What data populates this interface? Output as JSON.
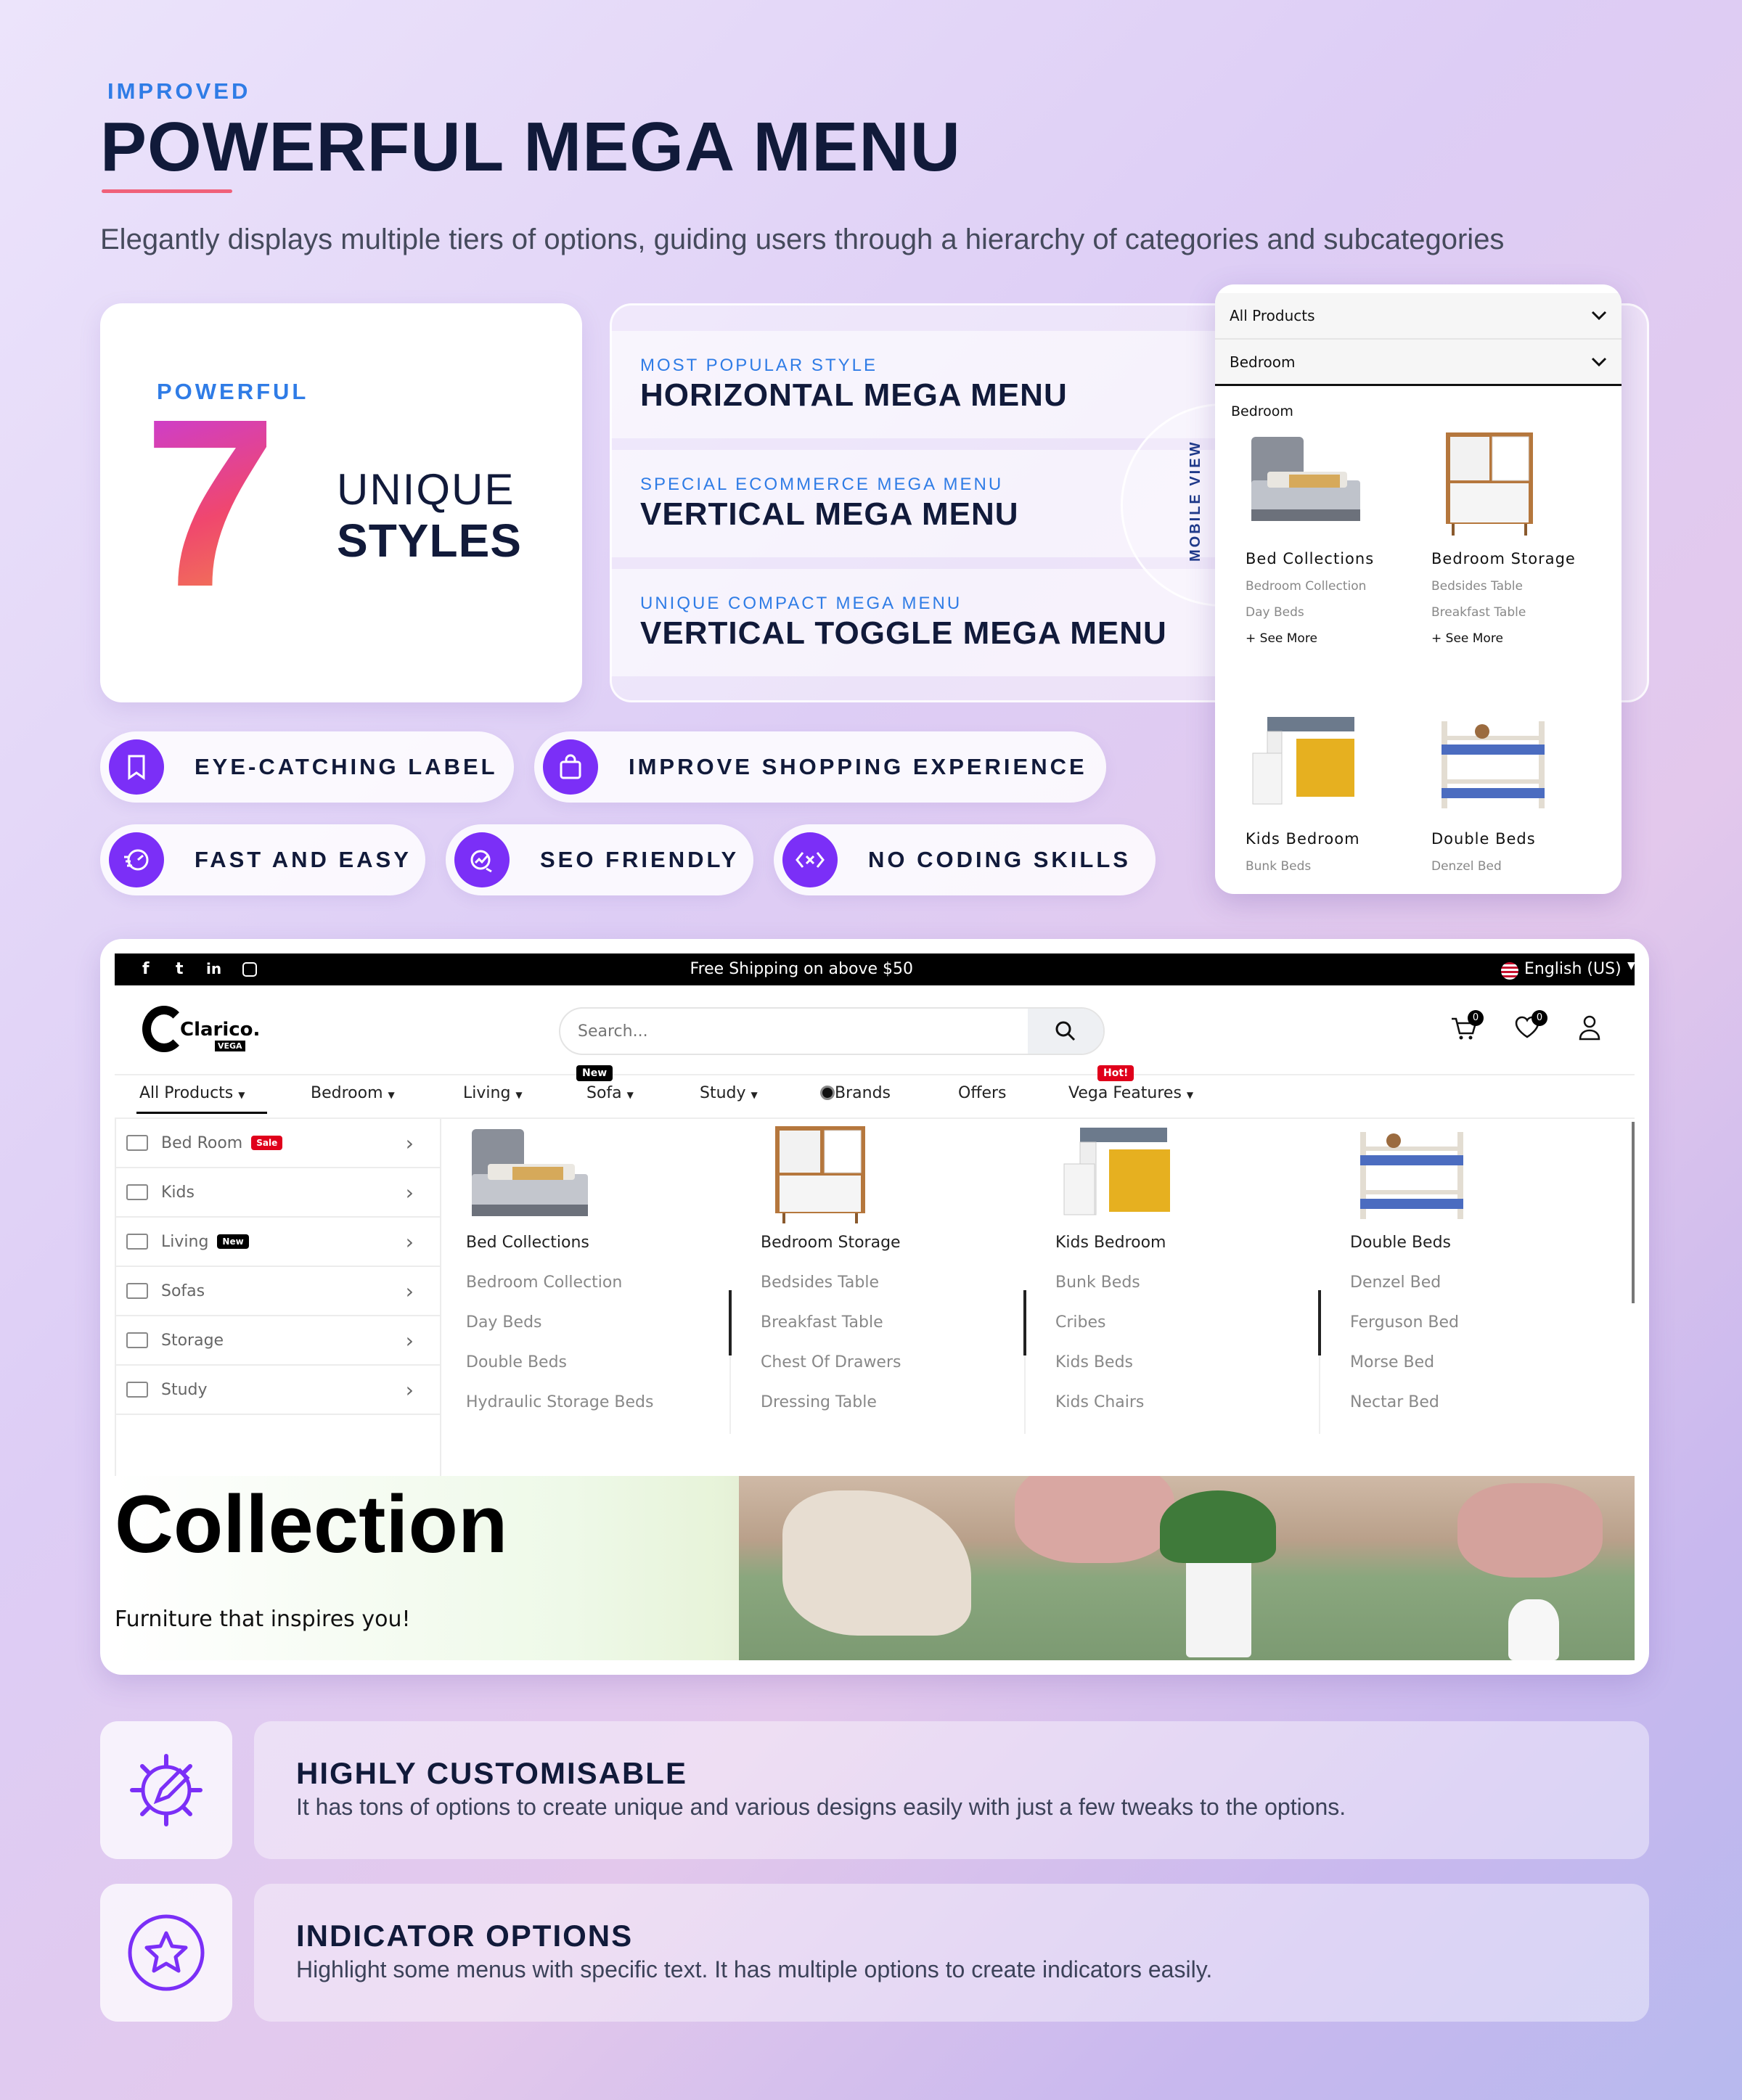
{
  "header": {
    "kicker": "IMPROVED",
    "title": "POWERFUL MEGA MENU",
    "subtitle": "Elegantly displays multiple tiers of options, guiding users through a hierarchy of categories and subcategories"
  },
  "styles_card": {
    "kicker": "POWERFUL",
    "number": "7",
    "line1": "UNIQUE",
    "line2": "STYLES"
  },
  "menu_styles": [
    {
      "kicker": "MOST POPULAR STYLE",
      "title": "HORIZONTAL MEGA MENU"
    },
    {
      "kicker": "SPECIAL ECOMMERCE MEGA MENU",
      "title": "VERTICAL MEGA MENU"
    },
    {
      "kicker": "UNIQUE COMPACT MEGA MENU",
      "title": "VERTICAL TOGGLE MEGA MENU"
    }
  ],
  "mobile_view_label": "MOBILE VIEW",
  "features": [
    "EYE-CATCHING LABEL",
    "IMPROVE SHOPPING EXPERIENCE",
    "FAST AND EASY",
    "SEO FRIENDLY",
    "NO CODING SKILLS"
  ],
  "mobile": {
    "select1": "All Products",
    "select2": "Bedroom",
    "section": "Bedroom",
    "products": [
      {
        "title": "Bed Collections",
        "sub1": "Bedroom Collection",
        "sub2": "Day Beds",
        "more": "+ See More"
      },
      {
        "title": "Bedroom Storage",
        "sub1": "Bedsides Table",
        "sub2": "Breakfast Table",
        "more": "+ See More"
      },
      {
        "title": "Kids Bedroom",
        "sub1": "Bunk Beds"
      },
      {
        "title": "Double Beds",
        "sub1": "Denzel Bed"
      }
    ]
  },
  "store": {
    "social": [
      "f",
      "t",
      "in",
      "ig"
    ],
    "announcement": "Free Shipping on above $50",
    "language": "English (US)",
    "logo": "Clarico.",
    "logo_sub": "VEGA",
    "search_placeholder": "Search...",
    "cart_count": "0",
    "wish_count": "0",
    "nav": [
      "All Products",
      "Bedroom",
      "Living",
      "Sofa",
      "Study",
      "Brands",
      "Offers",
      "Vega Features"
    ],
    "nav_badges": {
      "sofa": "New",
      "vega": "Hot!"
    },
    "sidebar": [
      {
        "label": "Bed Room",
        "badge": "Sale"
      },
      {
        "label": "Kids",
        "badge": ""
      },
      {
        "label": "Living",
        "badge": "New"
      },
      {
        "label": "Sofas",
        "badge": ""
      },
      {
        "label": "Storage",
        "badge": ""
      },
      {
        "label": "Study",
        "badge": ""
      }
    ],
    "columns": [
      {
        "title": "Bed Collections",
        "items": [
          "Bedroom Collection",
          "Day Beds",
          "Double Beds",
          "Hydraulic Storage Beds"
        ]
      },
      {
        "title": "Bedroom Storage",
        "items": [
          "Bedsides Table",
          "Breakfast Table",
          "Chest Of Drawers",
          "Dressing Table"
        ]
      },
      {
        "title": "Kids Bedroom",
        "items": [
          "Bunk Beds",
          "Cribes",
          "Kids Beds",
          "Kids Chairs"
        ]
      },
      {
        "title": "Double Beds",
        "items": [
          "Denzel Bed",
          "Ferguson Bed",
          "Morse Bed",
          "Nectar Bed"
        ]
      }
    ],
    "banner_title": "Collection",
    "banner_sub": "Furniture that inspires you!"
  },
  "bottom": [
    {
      "title": "HIGHLY CUSTOMISABLE",
      "text": "It has tons of options to create unique and various designs easily with just a few tweaks to the options."
    },
    {
      "title": "INDICATOR OPTIONS",
      "text": "Highlight some menus with specific text. It has multiple options to create indicators easily."
    }
  ],
  "colors": {
    "accent": "#7b2ff7",
    "blue": "#2f7ce6",
    "navy": "#111a3a",
    "sale": "#e0001b",
    "hot": "#e0001b"
  }
}
